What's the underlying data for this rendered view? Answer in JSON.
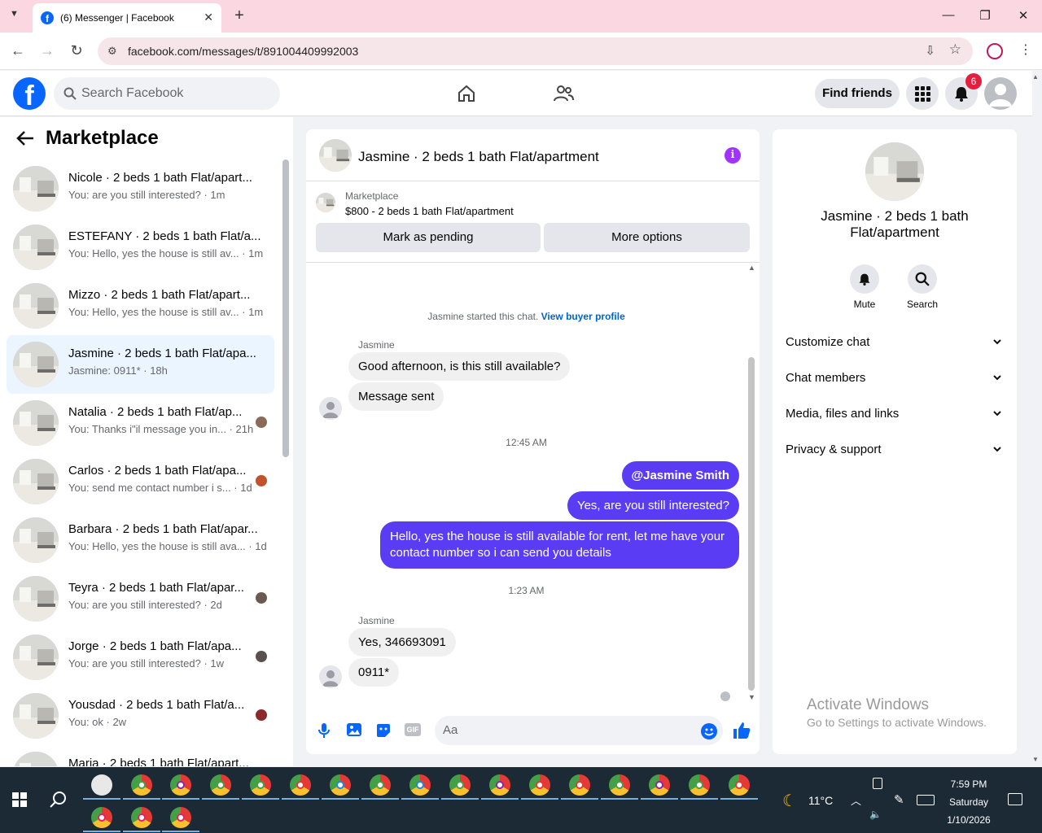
{
  "browser": {
    "tab_title": "(6) Messenger | Facebook",
    "url": "facebook.com/messages/t/891004409992003"
  },
  "header": {
    "search_placeholder": "Search Facebook",
    "find_friends": "Find friends",
    "notification_count": "6",
    "brand_color": "#0866ff"
  },
  "sidebar": {
    "title": "Marketplace",
    "conversations": [
      {
        "name": "Nicole · 2 beds 1 bath Flat/apart...",
        "snippet": "You: are you still interested? · 1m"
      },
      {
        "name": "ESTEFANY · 2 beds 1 bath Flat/a...",
        "snippet": "You: Hello, yes the house is still av... · 1m"
      },
      {
        "name": "Mizzo · 2 beds 1 bath Flat/apart...",
        "snippet": "You: Hello, yes the house is still av... · 1m"
      },
      {
        "name": "Jasmine · 2 beds 1 bath Flat/apa...",
        "snippet": "Jasmine: 0911* · 18h"
      },
      {
        "name": "Natalia · 2 beds 1 bath Flat/ap...",
        "snippet": "You: Thanks i\"il message you in... · 21h"
      },
      {
        "name": "Carlos · 2 beds 1 bath Flat/apa...",
        "snippet": "You: send me contact number i s... · 1d"
      },
      {
        "name": "Barbara · 2 beds 1 bath Flat/apar...",
        "snippet": "You: Hello, yes the house is still ava... · 1d"
      },
      {
        "name": "Teyra · 2 beds 1 bath Flat/apar...",
        "snippet": "You: are you still interested? · 2d"
      },
      {
        "name": "Jorge · 2 beds 1 bath Flat/apa...",
        "snippet": "You: are you still interested? · 1w"
      },
      {
        "name": "Yousdad · 2 beds 1 bath Flat/a...",
        "snippet": "You: ok · 2w"
      },
      {
        "name": "Maria · 2 beds 1 bath Flat/apart...",
        "snippet": ""
      }
    ]
  },
  "chat": {
    "title": "Jasmine · 2 beds 1 bath Flat/apartment",
    "listing_source": "Marketplace",
    "listing_price": "$800 - 2 beds 1 bath Flat/apartment",
    "mark_pending": "Mark as pending",
    "more_options": "More options",
    "system_text": "Jasmine started this chat.",
    "view_buyer": "View buyer profile",
    "sender1": "Jasmine",
    "in_msg1": "Good afternoon, is this still available?",
    "in_msg2": "Message sent",
    "time1": "12:45 AM",
    "out_msg1": "@Jasmine Smith",
    "out_msg2": "Yes, are you still interested?",
    "out_msg3": "Hello, yes the house is still available for rent, let me have your contact number so i can send you details",
    "time2": "1:23 AM",
    "sender2": "Jasmine",
    "in_msg3": "Yes, 346693091",
    "in_msg4": "0911*",
    "composer_placeholder": "Aa",
    "outgoing_color": "#5b3cf5"
  },
  "info_panel": {
    "title": "Jasmine · 2 beds 1 bath Flat/apartment",
    "mute": "Mute",
    "search": "Search",
    "sections": [
      "Customize chat",
      "Chat members",
      "Media, files and links",
      "Privacy & support"
    ]
  },
  "watermark": {
    "line1": "Activate Windows",
    "line2": "Go to Settings to activate Windows."
  },
  "taskbar": {
    "temperature": "11°C",
    "time": "7:59 PM",
    "day": "Saturday",
    "date": "1/10/2026"
  }
}
